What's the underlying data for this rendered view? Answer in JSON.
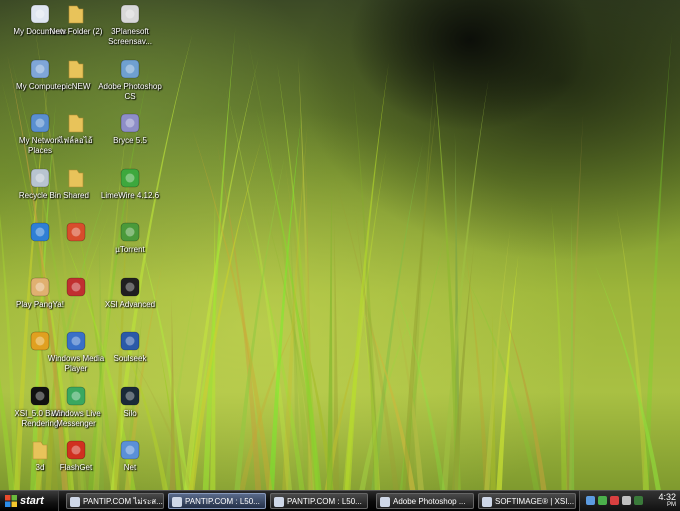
{
  "desktop": {
    "icons": [
      {
        "label": "My Documents",
        "icon": "my-documents-icon"
      },
      {
        "label": "New Folder (2)",
        "icon": "folder-icon"
      },
      {
        "label": "3Planesoft Screensav...",
        "icon": "screensaver-icon"
      },
      {
        "label": "My Computer",
        "icon": "my-computer-icon"
      },
      {
        "label": "picNEW",
        "icon": "folder-icon"
      },
      {
        "label": "Adobe Photoshop CS",
        "icon": "photoshop-icon"
      },
      {
        "label": "My Network Places",
        "icon": "network-places-icon"
      },
      {
        "label": "ไฟล์ลอไอ้",
        "icon": "folder-icon"
      },
      {
        "label": "Bryce 5.5",
        "icon": "bryce-icon"
      },
      {
        "label": "Recycle Bin",
        "icon": "recycle-bin-icon"
      },
      {
        "label": "Shared",
        "icon": "folder-icon"
      },
      {
        "label": "LimeWire 4.12.6",
        "icon": "limewire-icon"
      },
      {
        "label": "",
        "icon": "internet-explorer-icon"
      },
      {
        "label": "",
        "icon": "game-launcher-icon"
      },
      {
        "label": "µTorrent",
        "icon": "utorrent-icon"
      },
      {
        "label": "Play PangYa!",
        "icon": "pangya-icon"
      },
      {
        "label": "",
        "icon": "app-icon"
      },
      {
        "label": "XSI Advanced",
        "icon": "xsi-icon"
      },
      {
        "label": "",
        "icon": "game-icon"
      },
      {
        "label": "Windows Media Player",
        "icon": "media-player-icon"
      },
      {
        "label": "Soulseek",
        "icon": "soulseek-icon"
      },
      {
        "label": "XSI_5.0 Batch Rendering",
        "icon": "command-prompt-icon"
      },
      {
        "label": "Windows Live Messenger",
        "icon": "messenger-icon"
      },
      {
        "label": "Silo",
        "icon": "silo-icon"
      },
      {
        "label": "3d",
        "icon": "folder-icon"
      },
      {
        "label": "FlashGet",
        "icon": "flashget-icon"
      },
      {
        "label": "Net",
        "icon": "network-icon"
      }
    ]
  },
  "taskbar": {
    "start_label": "start",
    "tasks": [
      {
        "label": "PANTIP.COM ไม่ระส...",
        "active": false
      },
      {
        "label": "PANTIP.COM : L50...",
        "active": true
      },
      {
        "label": "PANTIP.COM : L50...",
        "active": false
      },
      {
        "label": "Adobe Photoshop ...",
        "active": false
      },
      {
        "label": "SOFTIMAGE® | XSI...",
        "active": false
      }
    ],
    "clock": {
      "time": "4:32",
      "ampm": "PM"
    }
  },
  "colors": {
    "wallpaper_green": "#9db63a",
    "taskbar": "#111111",
    "folder": "#e8c35a"
  }
}
